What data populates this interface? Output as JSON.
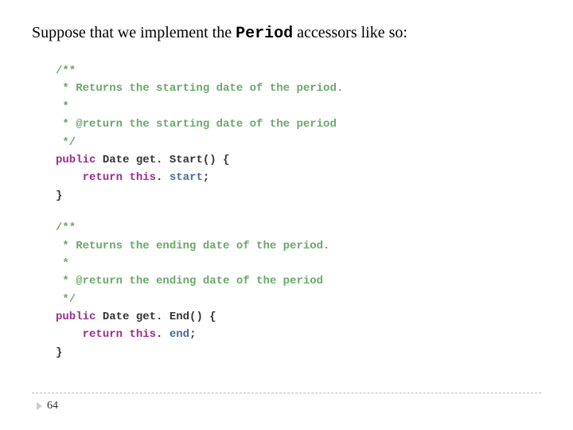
{
  "heading": {
    "pre": "Suppose that we implement the ",
    "mono": "Period",
    "post": " accessors like so:"
  },
  "code1": {
    "c1": "/**",
    "c2": " * Returns the starting date of the period.",
    "c3": " *",
    "c4": " * @return the starting date of the period",
    "c5": " */",
    "kw_public": "public",
    "type_date": "Date",
    "method": "get. Start() {",
    "kw_return": "return",
    "kw_this": "this",
    "dot": ". ",
    "field": "start",
    "semi": ";",
    "close": "}"
  },
  "code2": {
    "c1": "/**",
    "c2": " * Returns the ending date of the period.",
    "c3": " *",
    "c4": " * @return the ending date of the period",
    "c5": " */",
    "kw_public": "public",
    "type_date": "Date",
    "method": "get. End() {",
    "kw_return": "return",
    "kw_this": "this",
    "dot": ". ",
    "field": "end",
    "semi": ";",
    "close": "}"
  },
  "page_number": "64"
}
